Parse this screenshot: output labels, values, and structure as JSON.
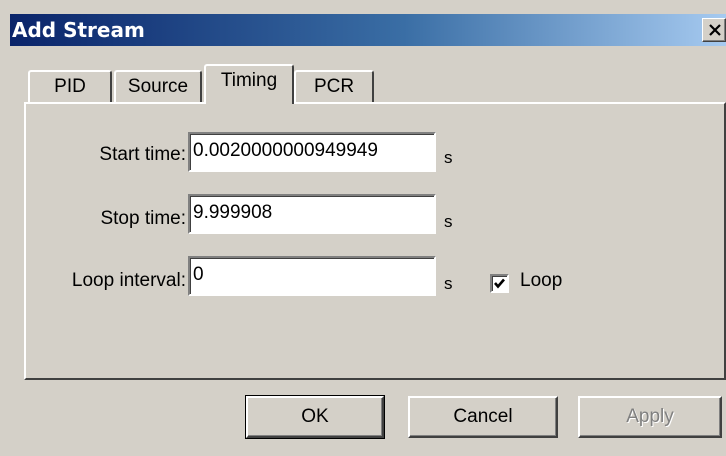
{
  "window": {
    "title": "Add Stream",
    "close_symbol": "X"
  },
  "tabs": [
    {
      "label": "PID",
      "active": false
    },
    {
      "label": "Source",
      "active": false
    },
    {
      "label": "Timing",
      "active": true
    },
    {
      "label": "PCR",
      "active": false
    }
  ],
  "timing": {
    "start_time": {
      "label": "Start time:",
      "value": "0.0020000000949949",
      "unit": "s"
    },
    "stop_time": {
      "label": "Stop time:",
      "value": "9.999908",
      "unit": "s"
    },
    "loop_interval": {
      "label": "Loop interval:",
      "value": "0",
      "unit": "s"
    },
    "loop": {
      "label": "Loop",
      "checked": true
    }
  },
  "buttons": {
    "ok": "OK",
    "cancel": "Cancel",
    "apply": "Apply"
  },
  "colors": {
    "title_bar_start": "#0a246a",
    "title_bar_end": "#a6caf0",
    "face": "#d4d0c8"
  },
  "icons": {
    "close": "close-icon",
    "checkbox_mark": "checkmark-icon"
  }
}
